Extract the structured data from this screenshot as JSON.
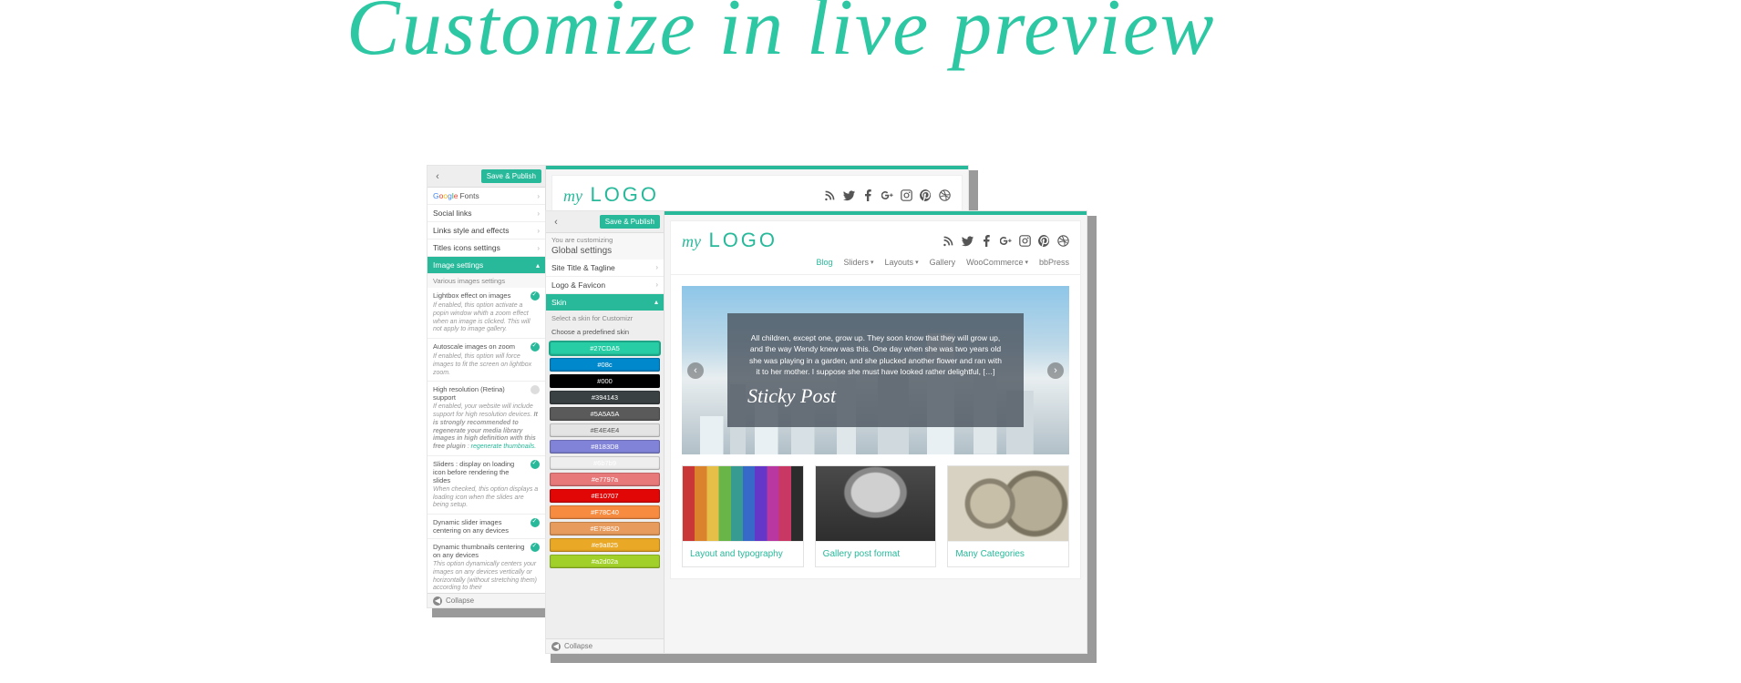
{
  "hero_title": "Customize in live preview",
  "common": {
    "save_publish": "Save & Publish",
    "collapse": "Collapse",
    "you_are_customizing": "You are customizing",
    "global_settings": "Global settings",
    "chevron_right": "›",
    "chevron_left": "‹"
  },
  "back_window": {
    "sections": [
      {
        "label_html_key": "google_fonts"
      },
      {
        "label": "Social links"
      },
      {
        "label": "Links style and effects"
      },
      {
        "label": "Titles icons settings"
      },
      {
        "label": "Image settings",
        "active": true
      }
    ],
    "google_fonts_word": "Google",
    "google_fonts_suffix": "Fonts",
    "image_settings": {
      "subhead": "Various images settings",
      "items": [
        {
          "title": "Lightbox effect on images",
          "on": true,
          "desc": "If enabled, this option activate a popin window whith a zoom effect when an image is clicked. This will not apply to image gallery."
        },
        {
          "title": "Autoscale images on zoom",
          "on": true,
          "desc": "If enabled, this option will force images to fit the screen on lightbox zoom."
        },
        {
          "title": "High resolution (Retina) support",
          "on": false,
          "desc": "If enabled, your website will include support for high resolution devices.",
          "desc_bold": "It is strongly recommended to regenerate your media library images in high definition with this free plugin",
          "desc_link": "regenerate thumbnails."
        },
        {
          "title": "Sliders : display on loading icon before rendering the slides",
          "on": true,
          "desc": "When checked, this option displays a loading icon when the slides are being setup."
        },
        {
          "title": "Dynamic slider images centering on any devices",
          "on": true
        },
        {
          "title": "Dynamic thumbnails centering on any devices",
          "on": true,
          "desc": "This option dynamically centers your images on any devices vertically or horizontally (without stretching them) according to their"
        }
      ]
    }
  },
  "front_window": {
    "sections": [
      {
        "label": "Site Title & Tagline"
      },
      {
        "label": "Logo & Favicon"
      },
      {
        "label": "Skin",
        "active": true
      }
    ],
    "skin_subhead": "Select a skin for Customizr",
    "skin_choose": "Choose a predefined skin",
    "swatches": [
      {
        "hex": "#27CDA5",
        "sel": true
      },
      {
        "hex": "#08c"
      },
      {
        "hex": "#000"
      },
      {
        "hex": "#394143"
      },
      {
        "hex": "#5A5A5A"
      },
      {
        "hex": "#E4E4E4",
        "light": true
      },
      {
        "hex": "#8183D8"
      },
      {
        "hex": "#6b7b9"
      },
      {
        "hex": "#e7797a"
      },
      {
        "hex": "#E10707"
      },
      {
        "hex": "#F78C40"
      },
      {
        "hex": "#E79B5D"
      },
      {
        "hex": "#e9a825"
      },
      {
        "hex": "#a2d02a"
      }
    ]
  },
  "site": {
    "logo_prefix": "my",
    "logo_word": "LOGO",
    "nav": [
      {
        "label": "Blog",
        "active": true
      },
      {
        "label": "Sliders",
        "caret": true
      },
      {
        "label": "Layouts",
        "caret": true
      },
      {
        "label": "Gallery"
      },
      {
        "label": "WooCommerce",
        "caret": true
      },
      {
        "label": "bbPress"
      }
    ],
    "hero_text": "All children, except one, grow up. They soon know that they will grow up, and the way Wendy knew was this. One day when she was two years old she was playing in a garden, and she plucked another flower and ran with it to her mother. I suppose she must have looked rather delightful, […]",
    "hero_sticky": "Sticky Post",
    "cards": [
      {
        "title": "Layout and typography",
        "img": "pencils"
      },
      {
        "title": "Gallery post format",
        "img": "station"
      },
      {
        "title": "Many Categories",
        "img": "gears"
      }
    ],
    "social_icons": [
      "rss",
      "twitter",
      "facebook",
      "google-plus",
      "instagram",
      "pinterest",
      "dribbble"
    ]
  }
}
